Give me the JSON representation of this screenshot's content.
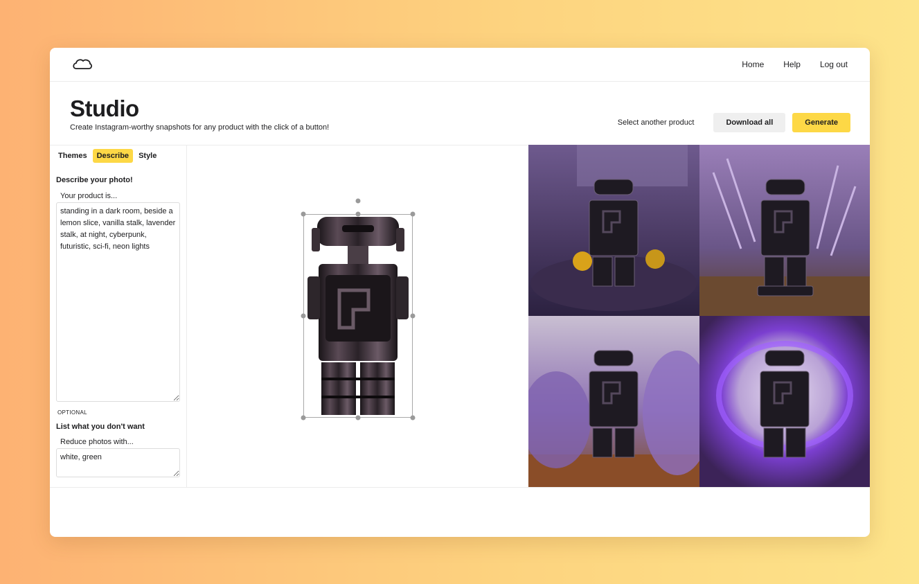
{
  "nav": {
    "logo_icon": "cloud-icon",
    "items": [
      "Home",
      "Help",
      "Log out"
    ]
  },
  "header": {
    "title": "Studio",
    "subtitle": "Create Instagram-worthy snapshots for any product with the click of a button!",
    "select_product": "Select another product",
    "download_all": "Download all",
    "generate": "Generate"
  },
  "sidebar": {
    "tabs": [
      {
        "label": "Themes",
        "active": false
      },
      {
        "label": "Describe",
        "active": true
      },
      {
        "label": "Style",
        "active": false
      }
    ],
    "describe_title": "Describe your photo!",
    "product_label": "Your product is...",
    "product_value": "standing in a dark room, beside a lemon slice, vanilla stalk, lavender stalk, at night, cyberpunk, futuristic, sci-fi, neon lights",
    "optional_label": "OPTIONAL",
    "negative_title": "List what you don't want",
    "negative_label": "Reduce photos with...",
    "negative_value": "white, green"
  },
  "colors": {
    "accent": "#fdd846",
    "secondary_button": "#efefef",
    "tile_purple": "#8a62b8"
  }
}
